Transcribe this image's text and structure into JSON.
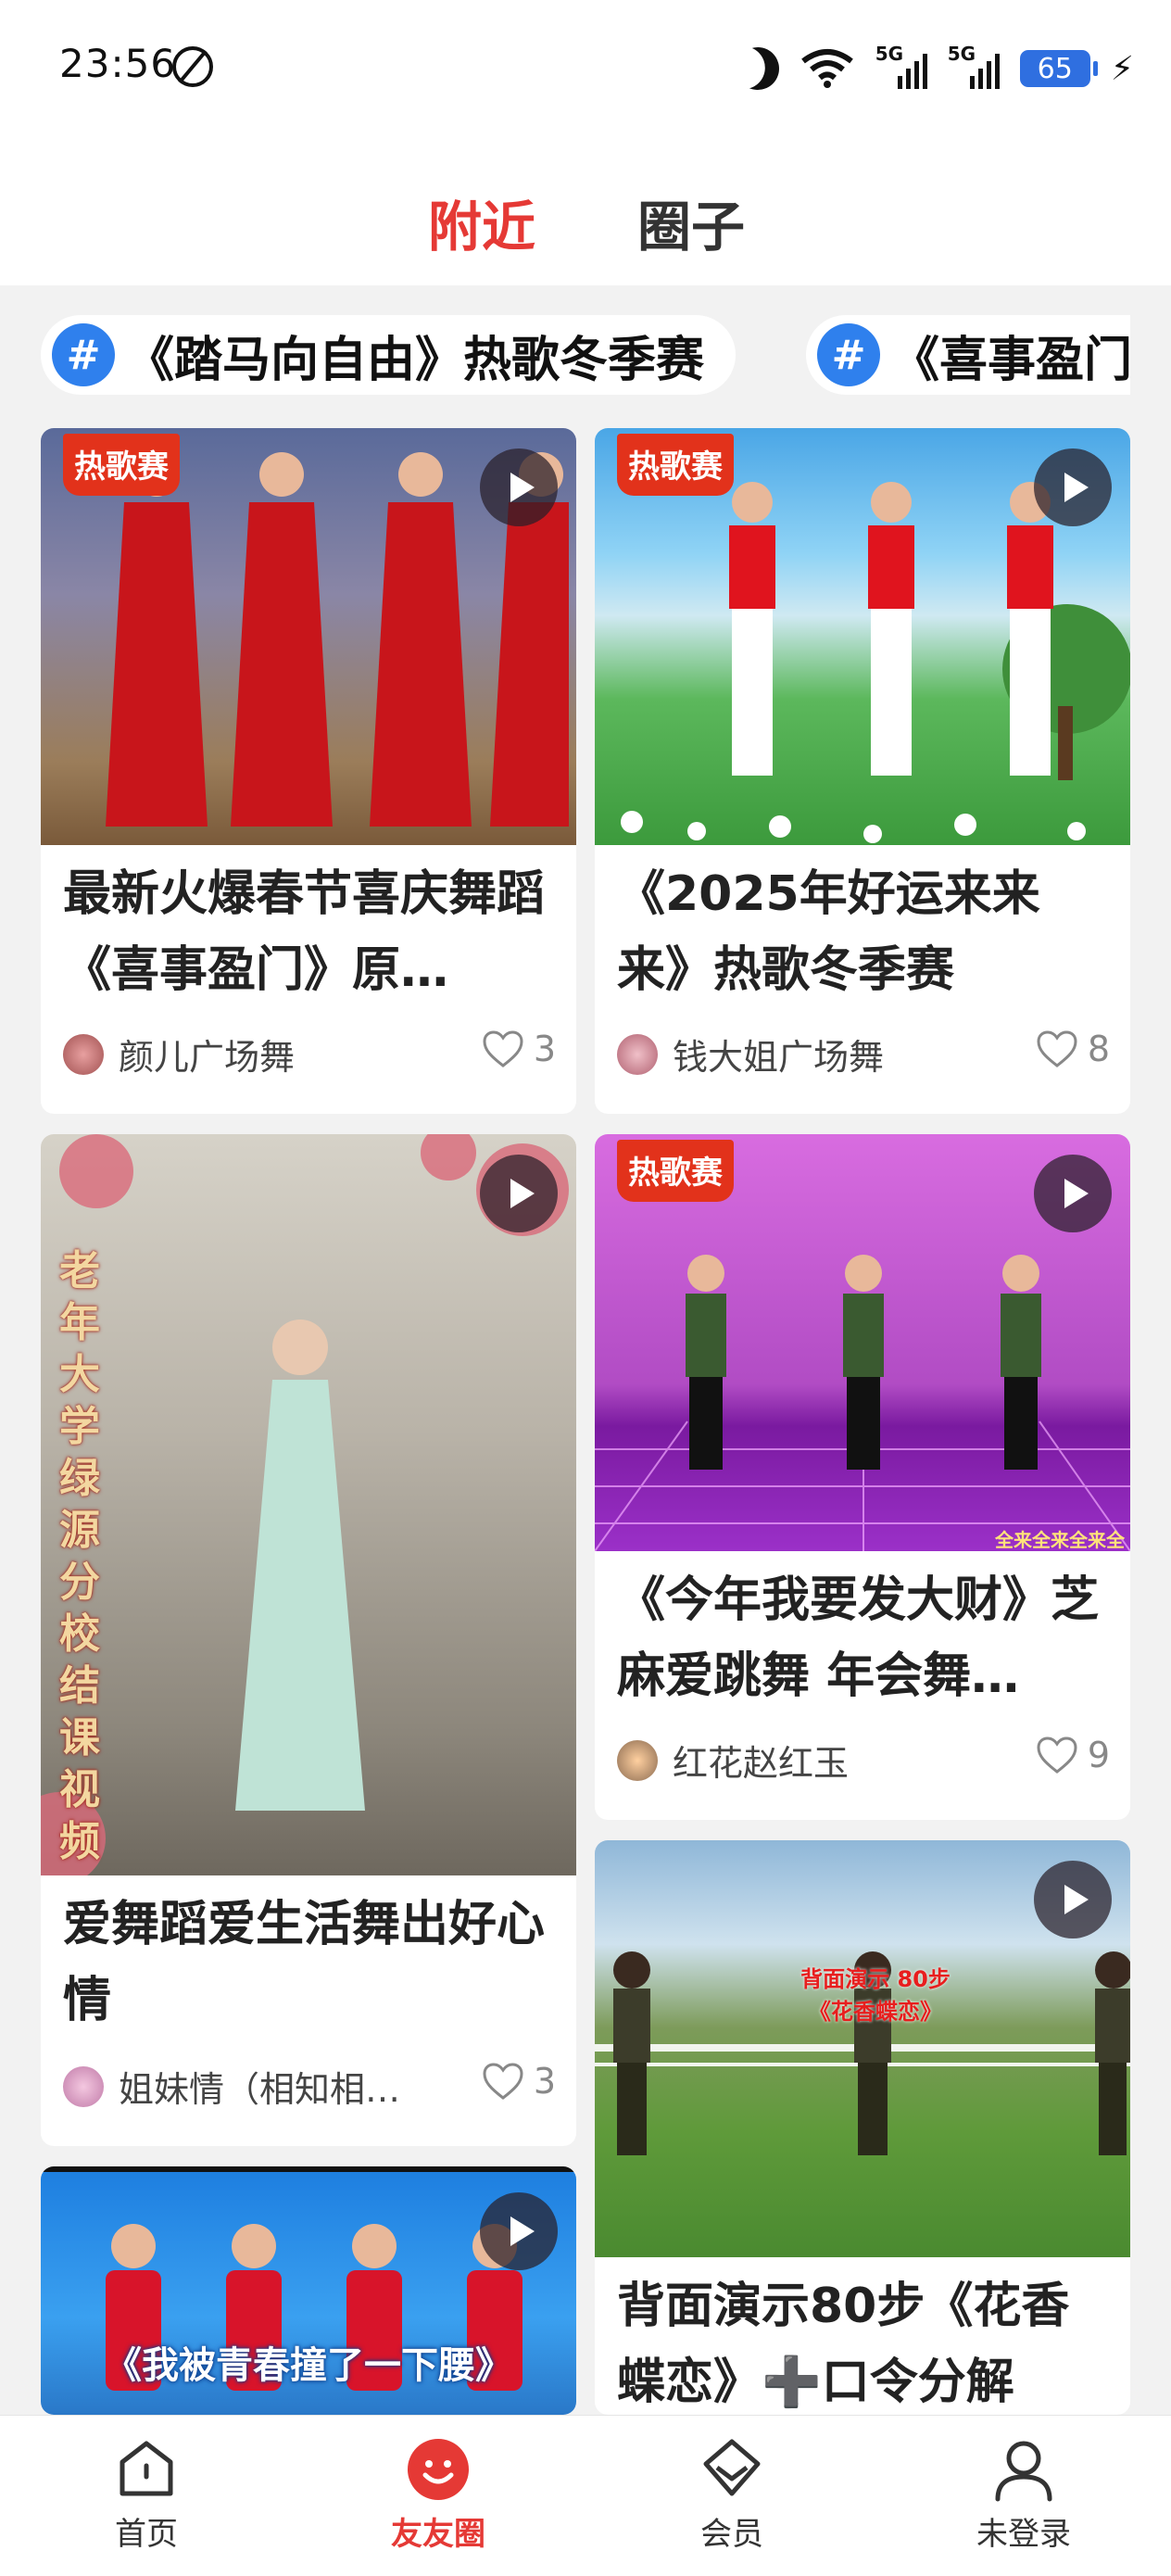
{
  "status_bar": {
    "time": "23:56",
    "battery": "65",
    "network_label": "5G"
  },
  "tabs": [
    {
      "label": "附近",
      "active": true
    },
    {
      "label": "圈子",
      "active": false
    }
  ],
  "topics": [
    {
      "icon": "hashtag-icon",
      "label": "《踏马向自由》热歌冬季赛"
    },
    {
      "icon": "hashtag-icon",
      "label": "《喜事盈门"
    }
  ],
  "cards": [
    {
      "badge": "热歌赛",
      "title": "最新火爆春节喜庆舞蹈《喜事盈门》原…",
      "author": "颜儿广场舞",
      "likes": "3"
    },
    {
      "badge": "热歌赛",
      "title": "《2025年好运来来来》热歌冬季赛",
      "author": "钱大姐广场舞",
      "likes": "8"
    },
    {
      "overlay": "老年大学绿源分校结课视频",
      "title": "爱舞蹈爱生活舞出好心情",
      "author": "姐妹情（相知相…",
      "likes": "3"
    },
    {
      "badge": "热歌赛",
      "overlay": "全来全来全来全",
      "title": "《今年我要发大财》芝麻爱跳舞 年会舞…",
      "author": "红花赵红玉",
      "likes": "9"
    },
    {
      "overlay": "《我被青春撞了一下腰》"
    },
    {
      "overlay": "背面演示 80步 《花香蝶恋》",
      "title": "背面演示80步《花香蝶恋》➕口令分解"
    }
  ],
  "nav": [
    {
      "label": "首页",
      "icon": "home-icon",
      "active": false
    },
    {
      "label": "友友圈",
      "icon": "smile-icon",
      "active": true
    },
    {
      "label": "会员",
      "icon": "diamond-icon",
      "active": false
    },
    {
      "label": "未登录",
      "icon": "user-icon",
      "active": false
    }
  ],
  "colors": {
    "accent": "#e53935",
    "hashtag": "#2f80ed",
    "badge": "#e2321b"
  }
}
